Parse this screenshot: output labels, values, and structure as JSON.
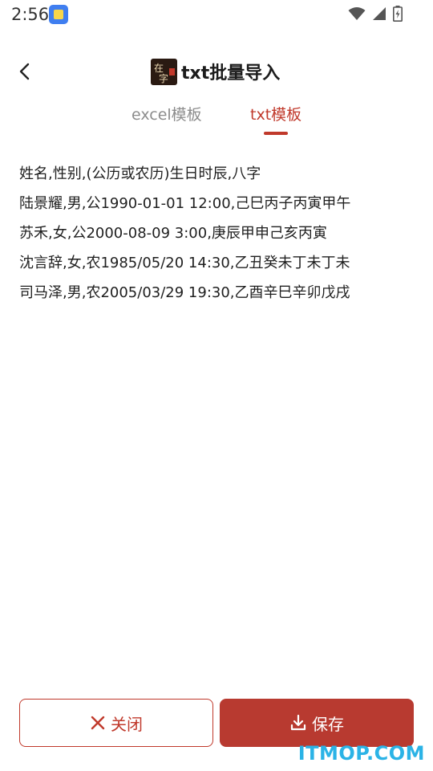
{
  "status_bar": {
    "time": "2:56"
  },
  "header": {
    "title": "txt批量导入"
  },
  "tabs": [
    {
      "label": "excel模板",
      "active": false
    },
    {
      "label": "txt模板",
      "active": true
    }
  ],
  "content": {
    "lines": [
      "姓名,性别,(公历或农历)生日时辰,八字",
      "陆景耀,男,公1990-01-01 12:00,己巳丙子丙寅甲午",
      "苏禾,女,公2000-08-09 3:00,庚辰甲申己亥丙寅",
      "沈言辞,女,农1985/05/20 14:30,乙丑癸未丁未丁未",
      "司马泽,男,农2005/03/29 19:30,乙酉辛巳辛卯戊戌"
    ]
  },
  "footer": {
    "close_label": "关闭",
    "save_label": "保存"
  },
  "watermark": "ITMOP.COM",
  "colors": {
    "accent": "#c0392b",
    "save_bg": "#b83a30",
    "inactive_tab": "#8c8c8c"
  }
}
